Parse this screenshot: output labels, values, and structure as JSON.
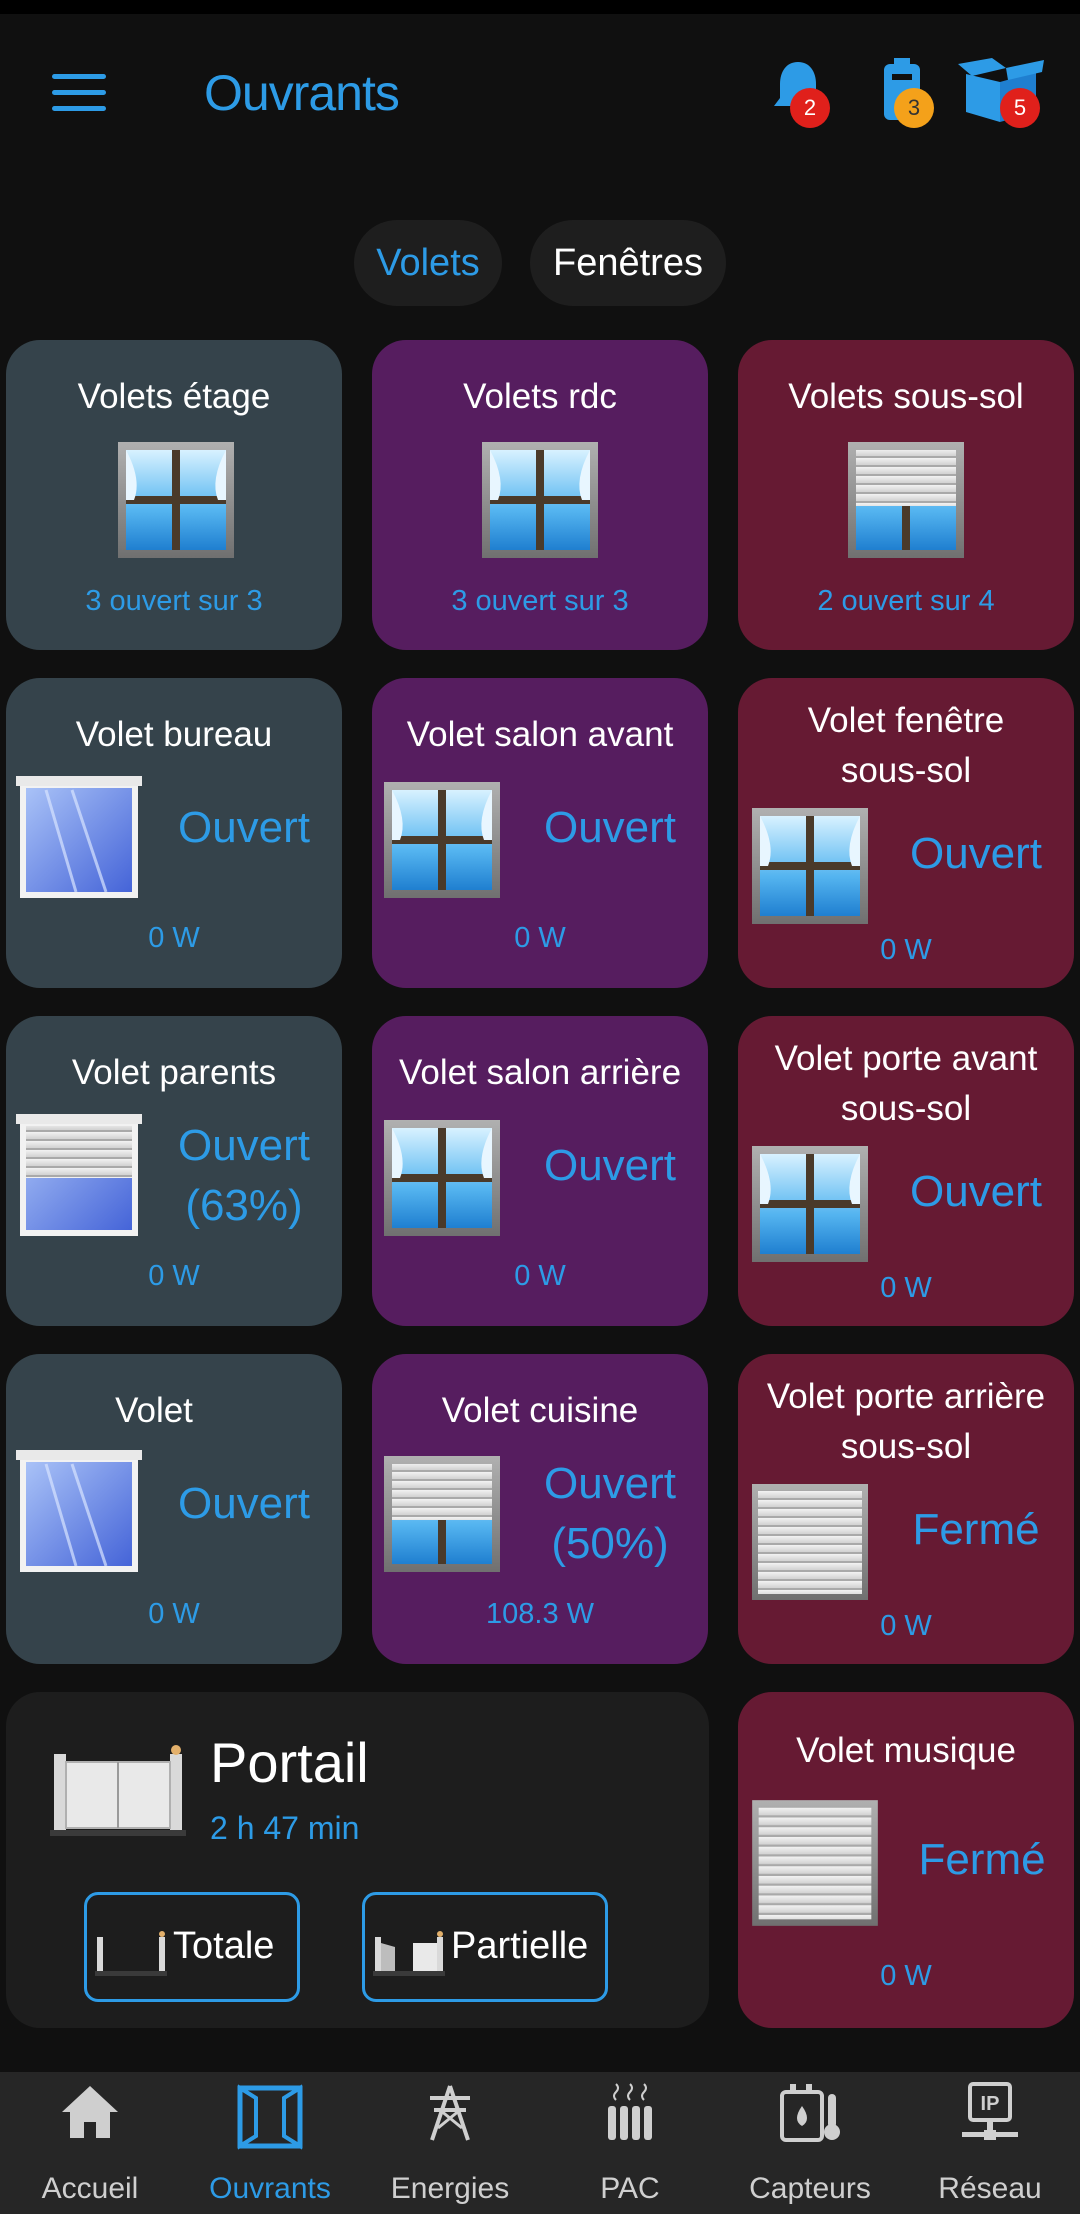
{
  "header": {
    "title": "Ouvrants",
    "badges": {
      "notifications": "2",
      "battery": "3",
      "packages": "5"
    }
  },
  "tabs": [
    "Volets",
    "Fenêtres"
  ],
  "cards": [
    {
      "title": "Volets étage",
      "sub": "3 ouvert sur 3"
    },
    {
      "title": "Volets rdc",
      "sub": "3 ouvert sur 3"
    },
    {
      "title": "Volets sous-sol",
      "sub": "2 ouvert sur 4"
    },
    {
      "title": "Volet bureau",
      "state": "Ouvert",
      "power": "0 W"
    },
    {
      "title": "Volet salon avant",
      "state": "Ouvert",
      "power": "0 W"
    },
    {
      "title": "Volet fenêtre sous-sol",
      "state": "Ouvert",
      "power": "0 W"
    },
    {
      "title": "Volet parents",
      "state": "Ouvert (63%)",
      "power": "0 W"
    },
    {
      "title": "Volet salon arrière",
      "state": "Ouvert",
      "power": "0 W"
    },
    {
      "title": "Volet porte avant sous-sol",
      "state": "Ouvert",
      "power": "0 W"
    },
    {
      "title": "Volet ",
      "state": "Ouvert",
      "power": "0 W"
    },
    {
      "title": "Volet cuisine",
      "state": "Ouvert (50%)",
      "power": "108.3 W"
    },
    {
      "title": "Volet porte arrière sous-sol",
      "state": "Fermé",
      "power": "0 W"
    },
    {
      "title": "Volet musique",
      "state": "Fermé",
      "power": "0 W"
    }
  ],
  "portail": {
    "title": "Portail",
    "elapsed": "2 h 47 min",
    "buttons": [
      "Totale",
      "Partielle"
    ]
  },
  "nav": [
    "Accueil",
    "Ouvrants",
    "Energies",
    "PAC",
    "Capteurs",
    "Réseau"
  ],
  "colors": {
    "accent": "#2d9be6",
    "slate_card": "#35434b",
    "purple_card": "#561d5f",
    "wine_card": "#661a33"
  }
}
